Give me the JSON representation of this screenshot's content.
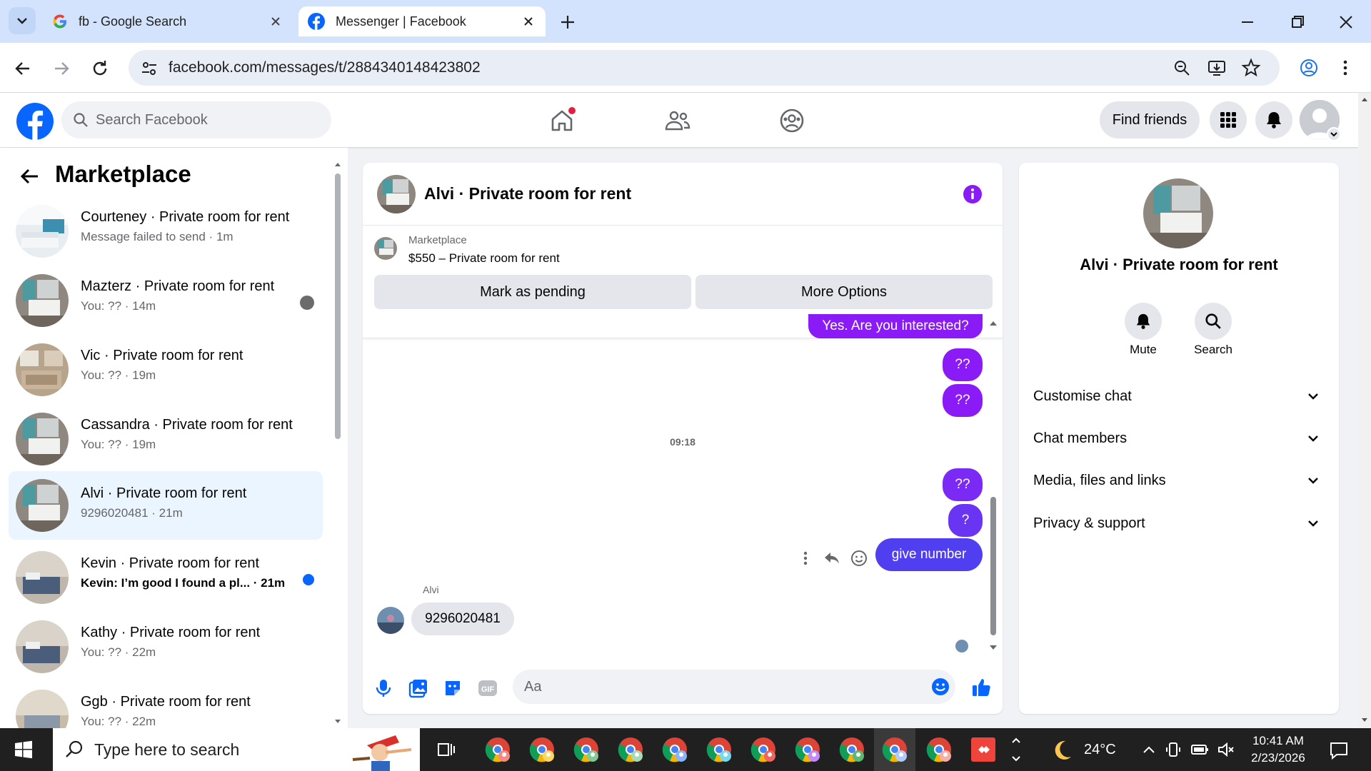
{
  "browser": {
    "tabs": [
      {
        "title": "fb - Google Search"
      },
      {
        "title": "Messenger | Facebook"
      }
    ],
    "url": "facebook.com/messages/t/2884340148423802"
  },
  "fb_header": {
    "search_placeholder": "Search Facebook",
    "find_friends": "Find friends"
  },
  "sidebar": {
    "title": "Marketplace",
    "conversations": [
      {
        "name": "Courteney · Private room for rent",
        "preview": "Message failed to send · 1m",
        "unread": false
      },
      {
        "name": "Mazterz · Private room for rent",
        "preview": "You: ?? · 14m",
        "unread": false
      },
      {
        "name": "Vic · Private room for rent",
        "preview": "You: ?? · 19m",
        "unread": false
      },
      {
        "name": "Cassandra · Private room for rent",
        "preview": "You: ?? · 19m",
        "unread": false
      },
      {
        "name": "Alvi · Private room for rent",
        "preview": "9296020481 · 21m",
        "unread": false
      },
      {
        "name": "Kevin · Private room for rent",
        "preview": "Kevin: I’m good I found a pl... · 21m",
        "unread": true
      },
      {
        "name": "Kathy · Private room for rent",
        "preview": "You: ?? · 22m",
        "unread": false
      },
      {
        "name": "Ggb · Private room for rent",
        "preview": "You: ?? · 22m",
        "unread": false
      }
    ]
  },
  "chat": {
    "title": "Alvi · Private room for rent",
    "listing_source": "Marketplace",
    "listing": "$550 – Private room for rent",
    "mark_pending": "Mark as pending",
    "more_options": "More Options",
    "messages": [
      {
        "text": "Yes. Are you interested?"
      },
      {
        "text": "??"
      },
      {
        "text": "??"
      },
      {
        "text": "??"
      },
      {
        "text": "?"
      },
      {
        "text": "give number"
      }
    ],
    "timestamp": "09:18",
    "incoming_sender": "Alvi",
    "incoming_text": "9296020481",
    "composer_placeholder": "Aa"
  },
  "info": {
    "title": "Alvi · Private room for rent",
    "mute": "Mute",
    "search": "Search",
    "sections": [
      "Customise chat",
      "Chat members",
      "Media, files and links",
      "Privacy & support"
    ]
  },
  "taskbar": {
    "search_placeholder": "Type here to search",
    "temperature": "24°C",
    "time": "10:41 AM",
    "date": "2/23/2026"
  },
  "colors": {
    "fb_blue": "#0866ff",
    "bubble_purple": "#8a1bf7",
    "bubble_blue": "#4f3ff0",
    "selected_row": "#ebf5ff"
  }
}
